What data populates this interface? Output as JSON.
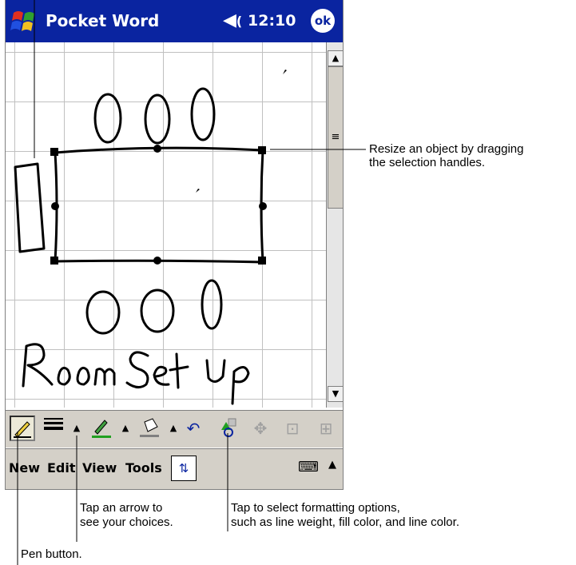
{
  "titlebar": {
    "app_title": "Pocket Word",
    "time": "12:10",
    "ok_label": "ok"
  },
  "menubar": {
    "items": [
      "New",
      "Edit",
      "View",
      "Tools"
    ]
  },
  "toolbar": {
    "pen": "pen-icon",
    "line_weight": "line-weight-icon",
    "line_color": "line-color-icon",
    "fill_color": "fill-color-icon",
    "undo": "undo-icon",
    "format": "format-icon"
  },
  "callouts": {
    "resize": [
      "Resize an object by dragging",
      "the selection handles."
    ],
    "arrow": [
      "Tap an arrow to",
      "see your choices."
    ],
    "format": [
      "Tap to select formatting options,",
      "such as line weight, fill color, and line color."
    ],
    "pen": "Pen button."
  },
  "colors": {
    "titlebar": "#0a24a0",
    "toolbar": "#d4d0c8",
    "grid": "#c0c0c0"
  }
}
